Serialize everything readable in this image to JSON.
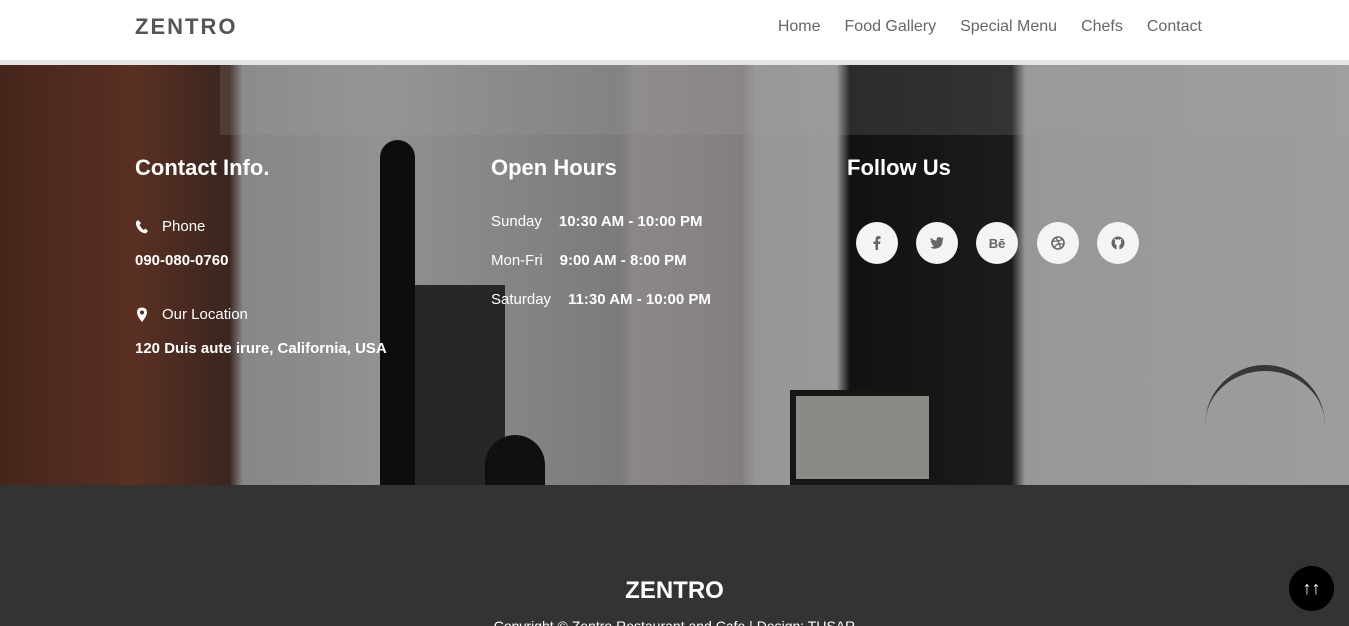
{
  "brand": "ZENTRO",
  "nav": {
    "items": [
      "Home",
      "Food Gallery",
      "Special Menu",
      "Chefs",
      "Contact"
    ]
  },
  "contact": {
    "title": "Contact Info.",
    "phone_label": "Phone",
    "phone_value": "090-080-0760",
    "location_label": "Our Location",
    "location_value": "120 Duis aute irure, California, USA"
  },
  "hours": {
    "title": "Open Hours",
    "rows": [
      {
        "day": "Sunday",
        "time": "10:30 AM - 10:00 PM"
      },
      {
        "day": "Mon-Fri",
        "time": "9:00 AM - 8:00 PM"
      },
      {
        "day": "Saturday",
        "time": "11:30 AM - 10:00 PM"
      }
    ]
  },
  "follow": {
    "title": "Follow Us",
    "icons": [
      {
        "name": "facebook-icon",
        "glyph": "f"
      },
      {
        "name": "twitter-icon",
        "glyph": "t"
      },
      {
        "name": "behance-icon",
        "glyph": "Bē"
      },
      {
        "name": "dribbble-icon",
        "glyph": "⚽"
      },
      {
        "name": "github-icon",
        "glyph": "◉"
      }
    ]
  },
  "footer": {
    "brand": "ZENTRO",
    "copyright": "Copyright © Zentro Restaurant and Cafe | Design: TUSAR"
  },
  "scroll_top": {
    "glyph": "↑↑"
  }
}
